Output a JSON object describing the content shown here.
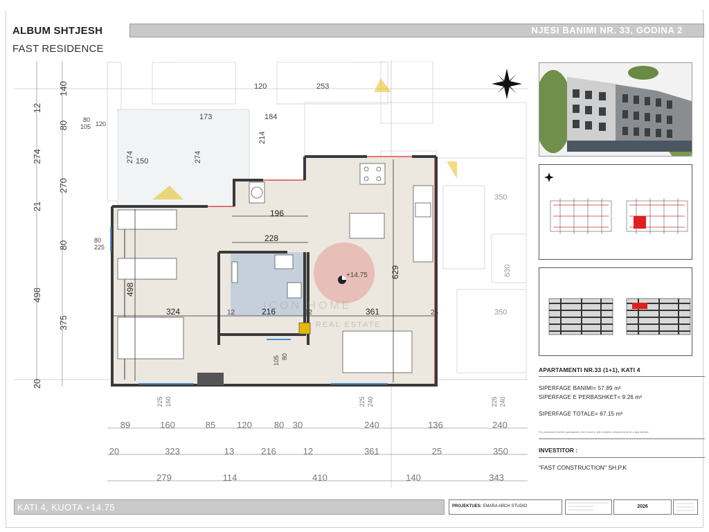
{
  "header": {
    "album_title": "ALBUM SHTJESH",
    "project_name": "FAST RESIDENCE",
    "unit_banner": "NJESI BANIMI NR. 33, GODINA 2"
  },
  "plan": {
    "level_label": "+14.75",
    "watermark_main": "ICON HOME",
    "watermark_sub": "REAL ESTATE",
    "left_dims": [
      "12",
      "140",
      "80",
      "274",
      "270",
      "21",
      "80",
      "498",
      "375",
      "20"
    ],
    "left_small": [
      "80",
      "105",
      "120",
      "80",
      "225"
    ],
    "room_dims": [
      "120",
      "253",
      "173",
      "184",
      "214",
      "274",
      "150",
      "274",
      "196",
      "228",
      "498",
      "324",
      "216",
      "361",
      "629",
      "12",
      "12",
      "25",
      "80",
      "105",
      "350",
      "630",
      "350"
    ],
    "bottom_small": [
      "225",
      "160",
      "225",
      "240",
      "225",
      "240"
    ],
    "row1": [
      "89",
      "160",
      "85",
      "120",
      "80",
      "30",
      "240",
      "136",
      "240"
    ],
    "row2": [
      "20",
      "323",
      "13",
      "216",
      "12",
      "361",
      "25",
      "350"
    ],
    "row3": [
      "279",
      "114",
      "410",
      "140",
      "343"
    ]
  },
  "apartment": {
    "title": "APARTAMENTI NR.33 (1+1), KATI 4",
    "area_net": "SIPERFAGE BANIMI=  57.89 m²",
    "area_shared": "SIPERFAGE E PERBASHKET=  9.26 m²",
    "area_total": "SIPERFAGE TOTALE=  67.15 m²",
    "note": "*Ky planimetri mebile parasqesite dhe mund te jete subjekt i ndryshimeve te vogla teknike"
  },
  "investor": {
    "label": "INVESTITOR :",
    "value": "\"FAST CONSTRUCTION\" SH.P.K"
  },
  "footer": {
    "floor_label": "KATI 4, KUOTA +14.75",
    "project_label": "PROJEKTUES:",
    "project_value": "EMARA ARCH STUDIO",
    "year": "2026"
  },
  "colors": {
    "banner_gray": "#c9c9c9",
    "apartment_fill": "#ece7df",
    "bathroom_fill": "#c6d0dc",
    "highlight_red": "#d92c2c",
    "wall": "#3a3a3a"
  },
  "icons": [
    "north-arrow-icon",
    "building-render-image",
    "key-plan-image",
    "elevation-image"
  ]
}
